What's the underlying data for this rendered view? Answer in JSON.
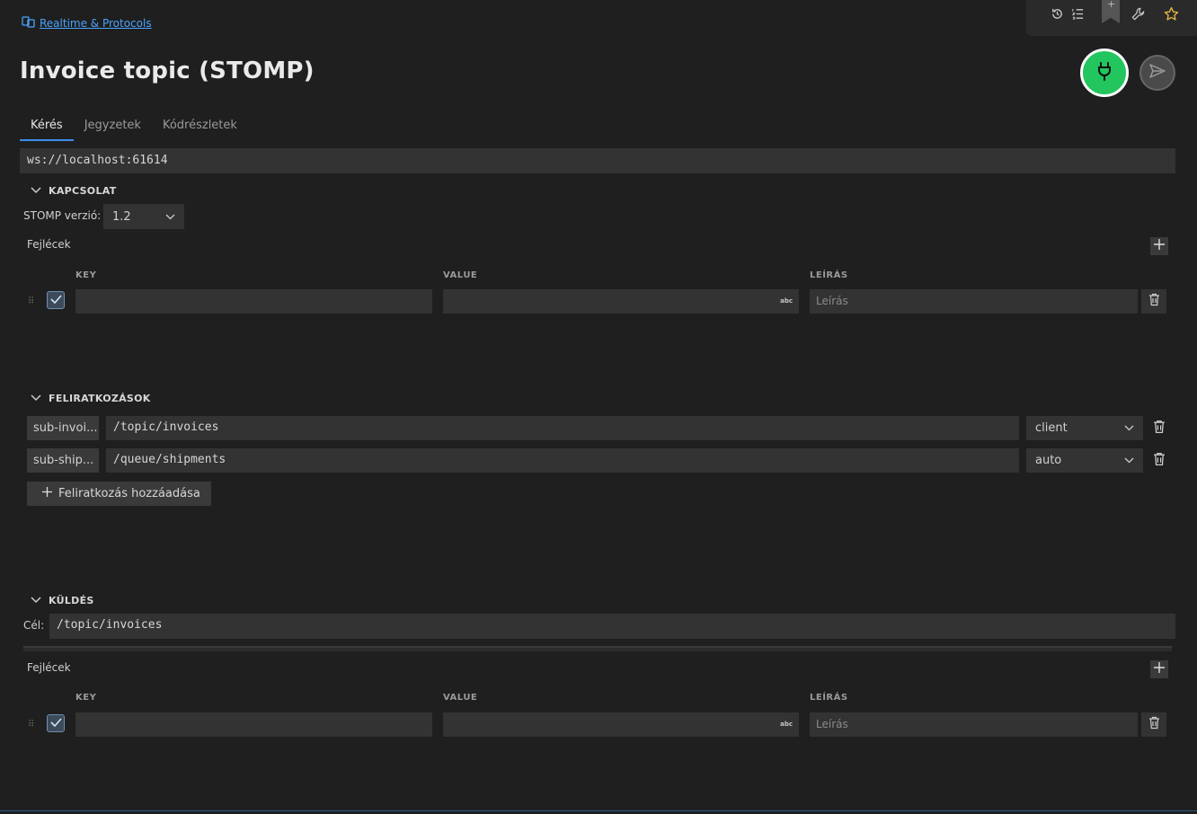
{
  "breadcrumb": {
    "label": "Realtime & Protocols"
  },
  "title": "Invoice topic (STOMP)",
  "tabs": [
    {
      "label": "Kérés",
      "active": true
    },
    {
      "label": "Jegyzetek",
      "active": false
    },
    {
      "label": "Kódrészletek",
      "active": false
    }
  ],
  "url": "ws://localhost:61614",
  "connection": {
    "heading": "KAPCSOLAT",
    "version_label": "STOMP verzió:",
    "version_value": "1.2",
    "headers_label": "Fejlécek",
    "columns": {
      "key": "KEY",
      "value": "VALUE",
      "description": "LEÍRÁS"
    },
    "row": {
      "key": "",
      "value": "",
      "description_placeholder": "Leírás",
      "value_badge": "abc",
      "checked": true
    }
  },
  "subscriptions": {
    "heading": "FELIRATKOZÁSOK",
    "items": [
      {
        "id": "sub-invoi...",
        "destination": "/topic/invoices",
        "ack": "client"
      },
      {
        "id": "sub-ship...",
        "destination": "/queue/shipments",
        "ack": "auto"
      }
    ],
    "add_label": "Feliratkozás hozzáadása"
  },
  "send": {
    "heading": "KÜLDÉS",
    "target_label": "Cél:",
    "target_value": "/topic/invoices",
    "headers_label": "Fejlécek",
    "columns": {
      "key": "KEY",
      "value": "VALUE",
      "description": "LEÍRÁS"
    },
    "row": {
      "key": "",
      "value": "",
      "description_placeholder": "Leírás",
      "value_badge": "abc",
      "checked": true
    }
  },
  "colors": {
    "accent": "#3b8eea",
    "connect": "#22c55e",
    "link": "#4aa3ff"
  }
}
